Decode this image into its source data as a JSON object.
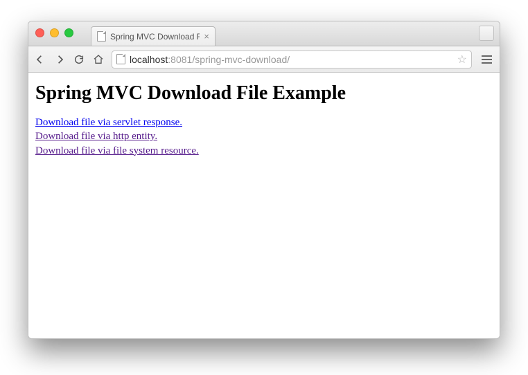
{
  "tab": {
    "title": "Spring MVC Download File"
  },
  "url": {
    "host": "localhost",
    "port": ":8081",
    "path": "/spring-mvc-download/"
  },
  "page": {
    "heading": "Spring MVC Download File Example",
    "links": [
      "Download file via servlet response.",
      "Download file via http entity.",
      "Download file via file system resource."
    ]
  }
}
